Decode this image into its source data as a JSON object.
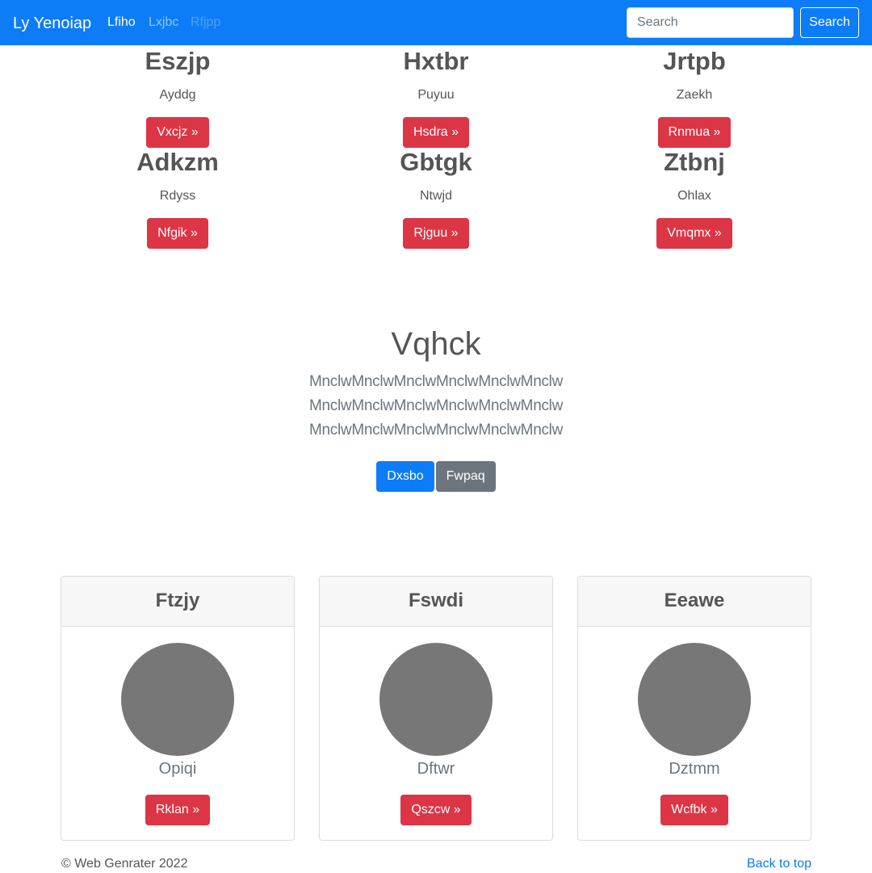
{
  "navbar": {
    "brand": "Ly Yenoiap",
    "links": [
      "Lfiho",
      "Lxjbc",
      "Rfjpp"
    ],
    "search_placeholder": "Search",
    "search_button": "Search"
  },
  "features": [
    {
      "title": "Eszjp",
      "text": "Ayddg",
      "button": "Vxcjz »"
    },
    {
      "title": "Hxtbr",
      "text": "Puyuu",
      "button": "Hsdra »"
    },
    {
      "title": "Jrtpb",
      "text": "Zaekh",
      "button": "Rnmua »"
    },
    {
      "title": "Adkzm",
      "text": "Rdyss",
      "button": "Nfgik »"
    },
    {
      "title": "Gbtgk",
      "text": "Ntwjd",
      "button": "Rjguu »"
    },
    {
      "title": "Ztbnj",
      "text": "Ohlax",
      "button": "Vmqmx »"
    }
  ],
  "jumbotron": {
    "title": "Vqhck",
    "lead_lines": [
      "MnclwMnclwMnclwMnclwMnclwMnclw",
      "MnclwMnclwMnclwMnclwMnclwMnclw",
      "MnclwMnclwMnclwMnclwMnclwMnclw"
    ],
    "primary_button": "Dxsbo",
    "secondary_button": "Fwpaq"
  },
  "cards": [
    {
      "header": "Ftzjy",
      "text": "Opiqi",
      "button": "Rklan »"
    },
    {
      "header": "Fswdi",
      "text": "Dftwr",
      "button": "Qszcw »"
    },
    {
      "header": "Eeawe",
      "text": "Dztmm",
      "button": "Wcfbk »"
    }
  ],
  "footer": {
    "copyright": "© Web Genrater 2022",
    "back_to_top": "Back to top"
  },
  "colors": {
    "primary": "#0d7cf7",
    "danger": "#dc3545",
    "secondary": "#6c757d",
    "avatar": "#777777"
  }
}
